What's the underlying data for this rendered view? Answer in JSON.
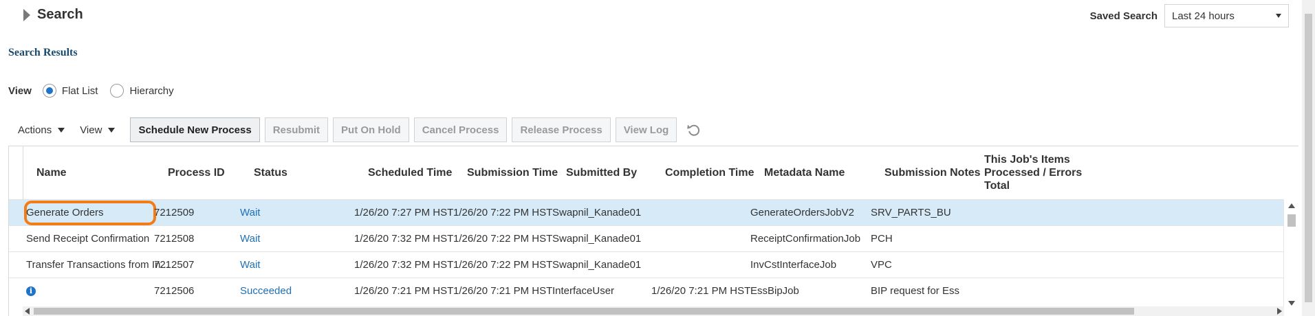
{
  "search": {
    "title": "Search",
    "expand_icon": "triangle-right-icon"
  },
  "saved_search": {
    "label": "Saved Search",
    "value": "Last 24 hours"
  },
  "results": {
    "title": "Search Results"
  },
  "view_mode": {
    "label": "View",
    "options": [
      "Flat List",
      "Hierarchy"
    ],
    "selected": "Flat List"
  },
  "toolbar": {
    "actions_label": "Actions",
    "view_label": "View",
    "buttons": [
      {
        "label": "Schedule New Process",
        "enabled": true
      },
      {
        "label": "Resubmit",
        "enabled": false
      },
      {
        "label": "Put On Hold",
        "enabled": false
      },
      {
        "label": "Cancel Process",
        "enabled": false
      },
      {
        "label": "Release Process",
        "enabled": false
      },
      {
        "label": "View Log",
        "enabled": false
      }
    ],
    "refresh_icon": "refresh-icon"
  },
  "table": {
    "columns": [
      "Name",
      "Process ID",
      "Status",
      "Scheduled Time",
      "Submission Time",
      "Submitted By",
      "Completion Time",
      "Metadata Name",
      "Submission Notes"
    ],
    "last_column": [
      "This Job's Items",
      "Processed / Errors",
      "Total"
    ],
    "rows": [
      {
        "name": "Generate Orders",
        "process_id": "7212509",
        "status": "Wait",
        "scheduled": "1/26/20 7:27 PM HST",
        "submitted": "1/26/20 7:22 PM HST",
        "by": "Swapnil_Kanade01",
        "completed": "",
        "metadata": "GenerateOrdersJobV2",
        "notes": "SRV_PARTS_BU",
        "selected": true
      },
      {
        "name": "Send Receipt Confirmation",
        "process_id": "7212508",
        "status": "Wait",
        "scheduled": "1/26/20 7:32 PM HST",
        "submitted": "1/26/20 7:22 PM HST",
        "by": "Swapnil_Kanade01",
        "completed": "",
        "metadata": "ReceiptConfirmationJob",
        "notes": "PCH",
        "selected": false
      },
      {
        "name": "Transfer Transactions from In...",
        "process_id": "7212507",
        "status": "Wait",
        "scheduled": "1/26/20 7:32 PM HST",
        "submitted": "1/26/20 7:22 PM HST",
        "by": "Swapnil_Kanade01",
        "completed": "",
        "metadata": "InvCstInterfaceJob",
        "notes": "VPC",
        "selected": false
      },
      {
        "name": "",
        "process_id": "7212506",
        "status": "Succeeded",
        "scheduled": "1/26/20 7:21 PM HST",
        "submitted": "1/26/20 7:21 PM HST",
        "by": "InterfaceUser",
        "completed": "1/26/20 7:21 PM HST",
        "metadata": "EssBipJob",
        "notes": "BIP request for Ess",
        "selected": false
      }
    ]
  },
  "colors": {
    "accent": "#1f73c9",
    "link": "#1f6fb5",
    "selected_row": "#d6eaf8",
    "highlight": "#f27d17",
    "results_title": "#1a4a6e"
  }
}
